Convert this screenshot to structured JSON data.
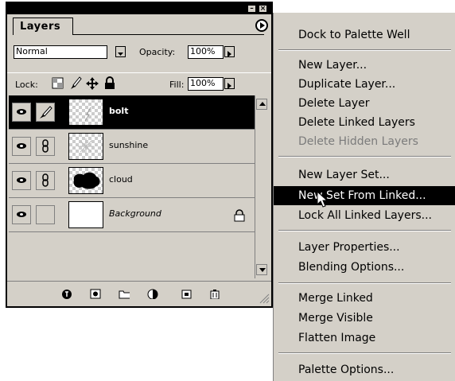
{
  "palette": {
    "tab_label": "Layers",
    "blend_mode": "Normal",
    "opacity_label": "Opacity:",
    "opacity_value": "100%",
    "lock_label": "Lock:",
    "fill_label": "Fill:",
    "fill_value": "100%",
    "layers": [
      {
        "name": "bolt",
        "selected": true,
        "link_icon": "brush-icon"
      },
      {
        "name": "sunshine",
        "selected": false,
        "link_icon": "chain-link-icon"
      },
      {
        "name": "cloud",
        "selected": false,
        "link_icon": "chain-link-icon"
      },
      {
        "name": "Background",
        "selected": false,
        "locked": true
      }
    ]
  },
  "menu": {
    "items": [
      {
        "label": "Dock to Palette Well"
      },
      {
        "label": "New Layer..."
      },
      {
        "label": "Duplicate Layer..."
      },
      {
        "label": "Delete Layer"
      },
      {
        "label": "Delete Linked Layers"
      },
      {
        "label": "Delete Hidden Layers",
        "disabled": true
      },
      {
        "label": "New Layer Set..."
      },
      {
        "label": "New Set From Linked...",
        "highlighted": true
      },
      {
        "label": "Lock All Linked Layers..."
      },
      {
        "label": "Layer Properties..."
      },
      {
        "label": "Blending Options..."
      },
      {
        "label": "Merge Linked"
      },
      {
        "label": "Merge Visible"
      },
      {
        "label": "Flatten Image"
      },
      {
        "label": "Palette Options..."
      }
    ]
  },
  "colors": {
    "selection": "#000000",
    "panel": "#d4d0c8",
    "disabled_text": "#7b7b7b"
  }
}
